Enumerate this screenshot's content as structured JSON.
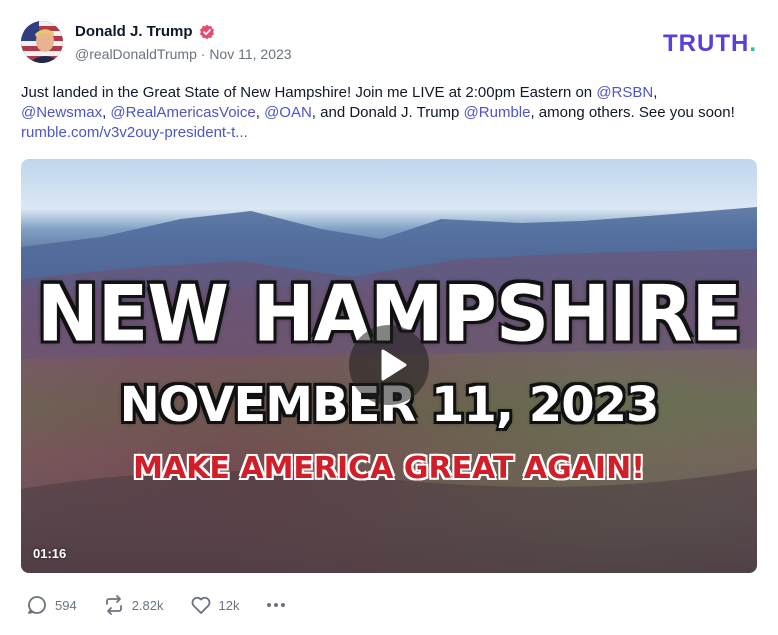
{
  "author": {
    "display_name": "Donald J. Trump",
    "handle": "@realDonaldTrump",
    "date": "Nov 11, 2023",
    "verified": true,
    "verified_color": "#e84a73"
  },
  "brand": {
    "text": "TRUTH",
    "dot": ".",
    "color": "#5b3fd6",
    "dot_color": "#22c3a6"
  },
  "post": {
    "text_1": "Just landed in the Great State of New Hampshire! Join me LIVE at 2:00pm Eastern on ",
    "m_rsbn": "@RSBN",
    "sep_1": ",",
    "m_newsmax": "@Newsmax",
    "sep_2": ", ",
    "m_rav": "@RealAmericasVoice",
    "sep_3": ", ",
    "m_oan": "@OAN",
    "text_2": ", and Donald J. Trump ",
    "m_rumble": "@Rumble",
    "text_3": ", among others. See you soon!",
    "link": "rumble.com/v3v2ouy-president-t..."
  },
  "video": {
    "line1": "NEW HAMPSHIRE",
    "line2": "NOVEMBER 11, 2023",
    "line3": "MAKE AMERICA GREAT AGAIN!",
    "duration": "01:16",
    "play_icon": "play-icon"
  },
  "actions": {
    "replies": "594",
    "retruths": "2.82k",
    "likes": "12k",
    "reply_icon": "comment-icon",
    "retruth_icon": "repost-icon",
    "like_icon": "heart-icon",
    "more_icon": "more-icon"
  }
}
